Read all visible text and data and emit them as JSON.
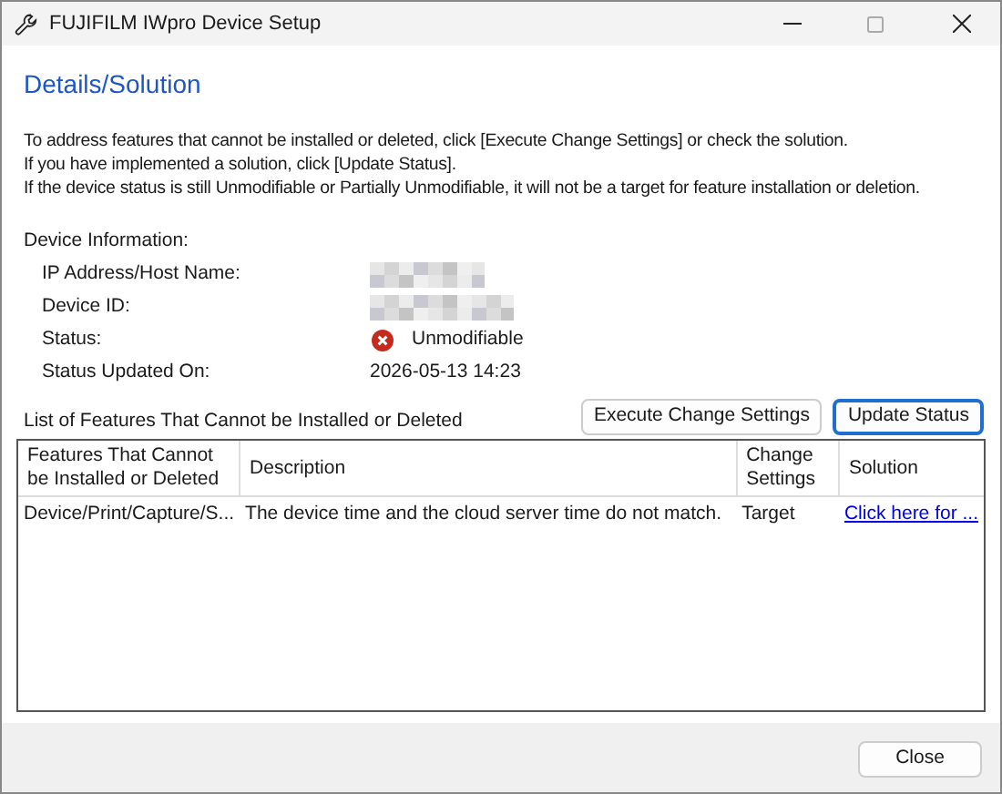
{
  "window": {
    "title": "FUJIFILM IWpro Device Setup"
  },
  "heading": "Details/Solution",
  "instructions": [
    "To address features that cannot be installed or deleted, click [Execute Change Settings] or check the solution.",
    "If you have implemented a solution, click [Update Status].",
    "If the device status is still Unmodifiable or Partially Unmodifiable, it will not be a target for feature installation or deletion."
  ],
  "device_info": {
    "label": "Device Information:",
    "fields": [
      {
        "label": "IP Address/Host Name:",
        "kind": "blurred"
      },
      {
        "label": "Device ID:",
        "kind": "blurred"
      },
      {
        "label": "Status:",
        "kind": "error_status",
        "value": "Unmodifiable"
      },
      {
        "label": "Status Updated On:",
        "kind": "text",
        "value": "2026-05-13 14:23"
      }
    ]
  },
  "list_label": "List of Features That Cannot be Installed or Deleted",
  "buttons": [
    {
      "label": "Execute Change Settings",
      "focused": false
    },
    {
      "label": "Update Status",
      "focused": true
    }
  ],
  "table": {
    "columns": [
      "Features That Cannot be Installed or Deleted",
      "Description",
      "Change Settings",
      "Solution"
    ],
    "rows": [
      [
        "Device/Print/Capture/S...",
        "The device time and the cloud server time do not match.",
        "Target",
        "Click here for ..."
      ]
    ]
  },
  "footer_buttons": [
    "Close"
  ]
}
